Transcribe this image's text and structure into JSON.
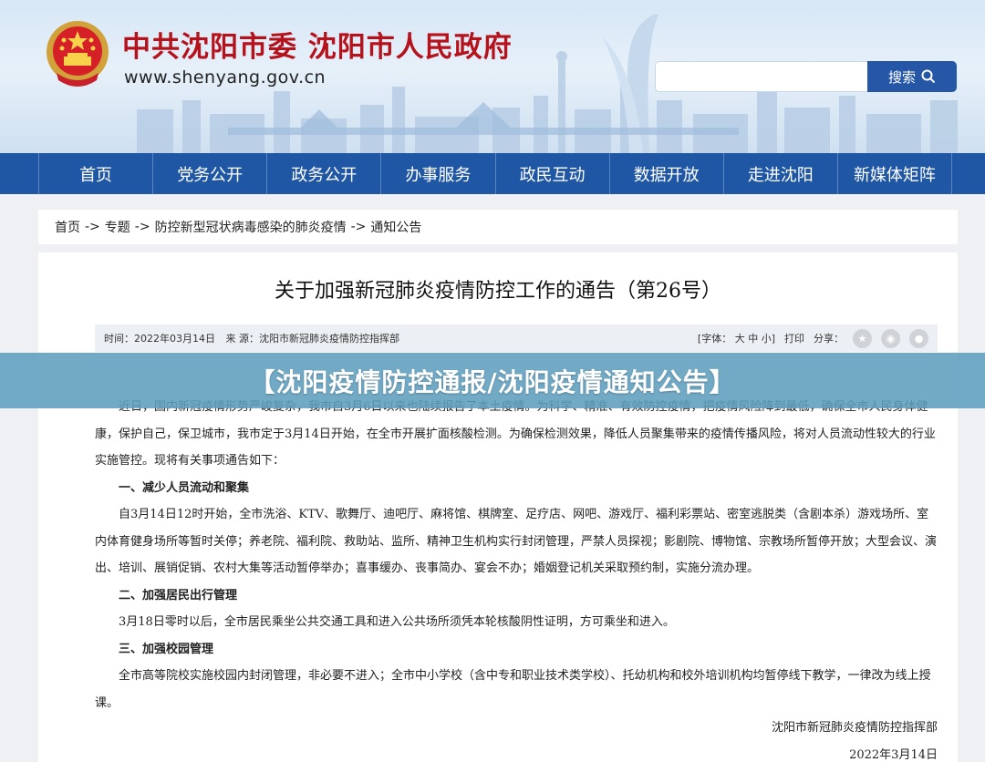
{
  "header": {
    "site_title": "中共沈阳市委 沈阳市人民政府",
    "site_url": "www.shenyang.gov.cn",
    "search": {
      "value": "",
      "button_label": "搜索"
    }
  },
  "nav": {
    "items": [
      {
        "label": "首页"
      },
      {
        "label": "党务公开"
      },
      {
        "label": "政务公开"
      },
      {
        "label": "办事服务"
      },
      {
        "label": "政民互动"
      },
      {
        "label": "数据开放"
      },
      {
        "label": "走进沈阳"
      },
      {
        "label": "新媒体矩阵"
      }
    ]
  },
  "breadcrumb": {
    "items": [
      "首页",
      "专题",
      "防控新型冠状病毒感染的肺炎疫情",
      "通知公告"
    ],
    "separator": "->"
  },
  "article": {
    "title": "关于加强新冠肺炎疫情防控工作的通告（第26号）",
    "meta": {
      "time": "时间：2022年03月14日",
      "source": "来 源：沈阳市新冠肺炎疫情防控指挥部",
      "font_size": "[字体： 大 中 小]",
      "print": "打印",
      "share": "分享："
    },
    "paragraphs": {
      "p1": "近日，国内新冠疫情形势严峻复杂，我市自3月6日以来也陆续报告了本土疫情。为科学、精准、有效防控疫情，把疫情风险降到最低，确保全市人民身体健康，保护自己，保卫城市，我市定于3月14日开始，在全市开展扩面核酸检测。为确保检测效果，降低人员聚集带来的疫情传播风险，将对人员流动性较大的行业实施管控。现将有关事项通告如下：",
      "h1": "一、减少人员流动和聚集",
      "p2": "自3月14日12时开始，全市洗浴、KTV、歌舞厅、迪吧厅、麻将馆、棋牌室、足疗店、网吧、游戏厅、福利彩票站、密室逃脱类（含剧本杀）游戏场所、室内体育健身场所等暂时关停；养老院、福利院、救助站、监所、精神卫生机构实行封闭管理，严禁人员探视；影剧院、博物馆、宗教场所暂停开放；大型会议、演出、培训、展销促销、农村大集等活动暂停举办；喜事缓办、丧事简办、宴会不办；婚姻登记机关采取预约制，实施分流办理。",
      "h2": "二、加强居民出行管理",
      "p3": "3月18日零时以后，全市居民乘坐公共交通工具和进入公共场所须凭本轮核酸阴性证明，方可乘坐和进入。",
      "h3": "三、加强校园管理",
      "p4": "全市高等院校实施校园内封闭管理，非必要不进入；全市中小学校（含中专和职业技术类学校）、托幼机构和校外培训机构均暂停线下教学，一律改为线上授课。"
    },
    "signature": "沈阳市新冠肺炎疫情防控指挥部",
    "date": "2022年3月14日"
  },
  "banner": {
    "text": "【沈阳疫情防控通报/沈阳疫情通知公告】"
  },
  "colors": {
    "nav_bg": "#1f57a5",
    "title_red": "#b5121b",
    "banner_bg": "#5e9ebe",
    "search_btn": "#2557a6"
  },
  "icons": [
    "national-emblem-icon",
    "search-icon",
    "weibo-icon",
    "wechat-icon",
    "share-icon"
  ]
}
